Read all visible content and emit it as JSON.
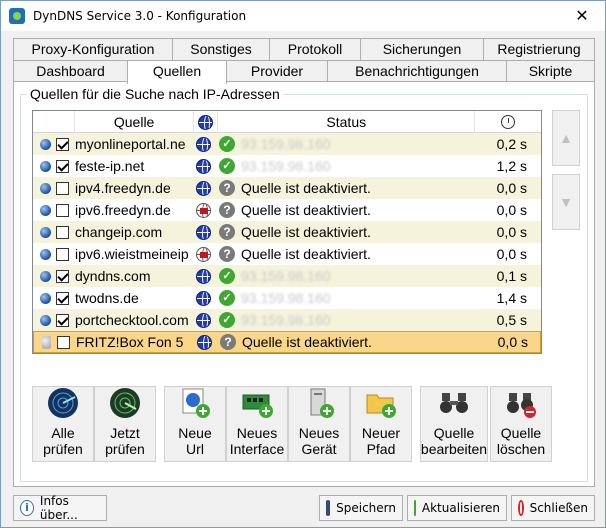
{
  "window": {
    "title": "DynDNS Service 3.0 - Konfiguration",
    "close_glyph": "✕"
  },
  "tabs_top": [
    "Proxy-Konfiguration",
    "Sonstiges",
    "Protokoll",
    "Sicherungen",
    "Registrierung"
  ],
  "tabs_bottom": [
    "Dashboard",
    "Quellen",
    "Provider",
    "Benachrichtigungen",
    "Skripte"
  ],
  "active_tab": "Quellen",
  "group": {
    "title": "Quellen für die Suche nach IP-Adressen"
  },
  "table": {
    "headers": {
      "source": "Quelle",
      "status": "Status"
    },
    "header_icons": {
      "network": "globe-icon",
      "time": "clock-icon"
    },
    "rows": [
      {
        "name": "myonlineportal.ne",
        "checked": true,
        "globe": "ipv4",
        "state": "ok",
        "status": "93.159.98.160",
        "time": "0,2 s"
      },
      {
        "name": "feste-ip.net",
        "checked": true,
        "globe": "ipv4",
        "state": "ok",
        "status": "93.159.98.160",
        "time": "1,2 s"
      },
      {
        "name": "ipv4.freedyn.de",
        "checked": false,
        "globe": "ipv4",
        "state": "disabled",
        "status": "Quelle ist deaktiviert.",
        "time": "0,0 s"
      },
      {
        "name": "ipv6.freedyn.de",
        "checked": false,
        "globe": "ipv6",
        "state": "disabled",
        "status": "Quelle ist deaktiviert.",
        "time": "0,0 s"
      },
      {
        "name": "changeip.com",
        "checked": false,
        "globe": "ipv4",
        "state": "disabled",
        "status": "Quelle ist deaktiviert.",
        "time": "0,0 s"
      },
      {
        "name": "ipv6.wieistmeineip",
        "checked": false,
        "globe": "ipv6",
        "state": "disabled",
        "status": "Quelle ist deaktiviert.",
        "time": "0,0 s"
      },
      {
        "name": "dyndns.com",
        "checked": true,
        "globe": "ipv4",
        "state": "ok",
        "status": "93.159.98.160",
        "time": "0,1 s"
      },
      {
        "name": "twodns.de",
        "checked": true,
        "globe": "ipv4",
        "state": "ok",
        "status": "93.159.98.160",
        "time": "1,4 s"
      },
      {
        "name": "portchecktool.com",
        "checked": true,
        "globe": "ipv4",
        "state": "ok",
        "status": "93.159.98.160",
        "time": "0,5 s"
      },
      {
        "name": "FRITZ!Box Fon 5",
        "checked": false,
        "globe": "ipv4",
        "state": "disabled",
        "status": "Quelle ist deaktiviert.",
        "time": "0,0 s",
        "selected": true,
        "device": true
      }
    ]
  },
  "side_buttons": {
    "up": "▲",
    "down": "▼"
  },
  "toolbar": [
    {
      "id": "check-all",
      "label1": "Alle",
      "label2": "prüfen",
      "icon": "radar-icon"
    },
    {
      "id": "check-now",
      "label1": "Jetzt",
      "label2": "prüfen",
      "icon": "radar-green-icon"
    },
    {
      "id": "new-url",
      "label1": "Neue",
      "label2": "Url",
      "icon": "url-add-icon"
    },
    {
      "id": "new-interface",
      "label1": "Neues",
      "label2": "Interface",
      "icon": "network-card-add-icon"
    },
    {
      "id": "new-device",
      "label1": "Neues",
      "label2": "Gerät",
      "icon": "device-add-icon"
    },
    {
      "id": "new-path",
      "label1": "Neuer",
      "label2": "Pfad",
      "icon": "folder-add-icon"
    },
    {
      "id": "edit-source",
      "label1": "Quelle",
      "label2": "bearbeiten",
      "icon": "binoculars-icon"
    },
    {
      "id": "delete-source",
      "label1": "Quelle",
      "label2": "löschen",
      "icon": "binoculars-delete-icon"
    }
  ],
  "footer": {
    "info": "Infos über...",
    "save": "Speichern",
    "update": "Aktualisieren",
    "close": "Schließen"
  },
  "colors": {
    "accent": "#1e3bbf",
    "ok": "#3fa832",
    "row_alt": "#f5f3dc",
    "row_selected": "#fad68a"
  }
}
